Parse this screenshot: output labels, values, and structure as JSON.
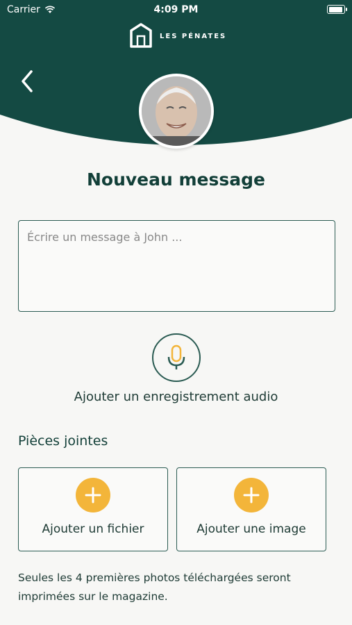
{
  "status_bar": {
    "carrier": "Carrier",
    "time": "4:09 PM"
  },
  "brand": {
    "name": "LES PÉNATES"
  },
  "colors": {
    "header": "#144a43",
    "accent": "#f3b53a",
    "border": "#2a5b52"
  },
  "header": {
    "back_icon": "chevron-left-icon",
    "avatar": "profile-photo"
  },
  "page": {
    "title": "Nouveau message"
  },
  "message": {
    "placeholder": "Écrire un message à John ..."
  },
  "audio": {
    "icon": "microphone-icon",
    "label": "Ajouter un enregistrement audio"
  },
  "attachments": {
    "title": "Pièces jointes",
    "add_file_label": "Ajouter un fichier",
    "add_image_label": "Ajouter une image",
    "note": "Seules les 4 premières photos téléchargées seront imprimées sur le magazine."
  }
}
